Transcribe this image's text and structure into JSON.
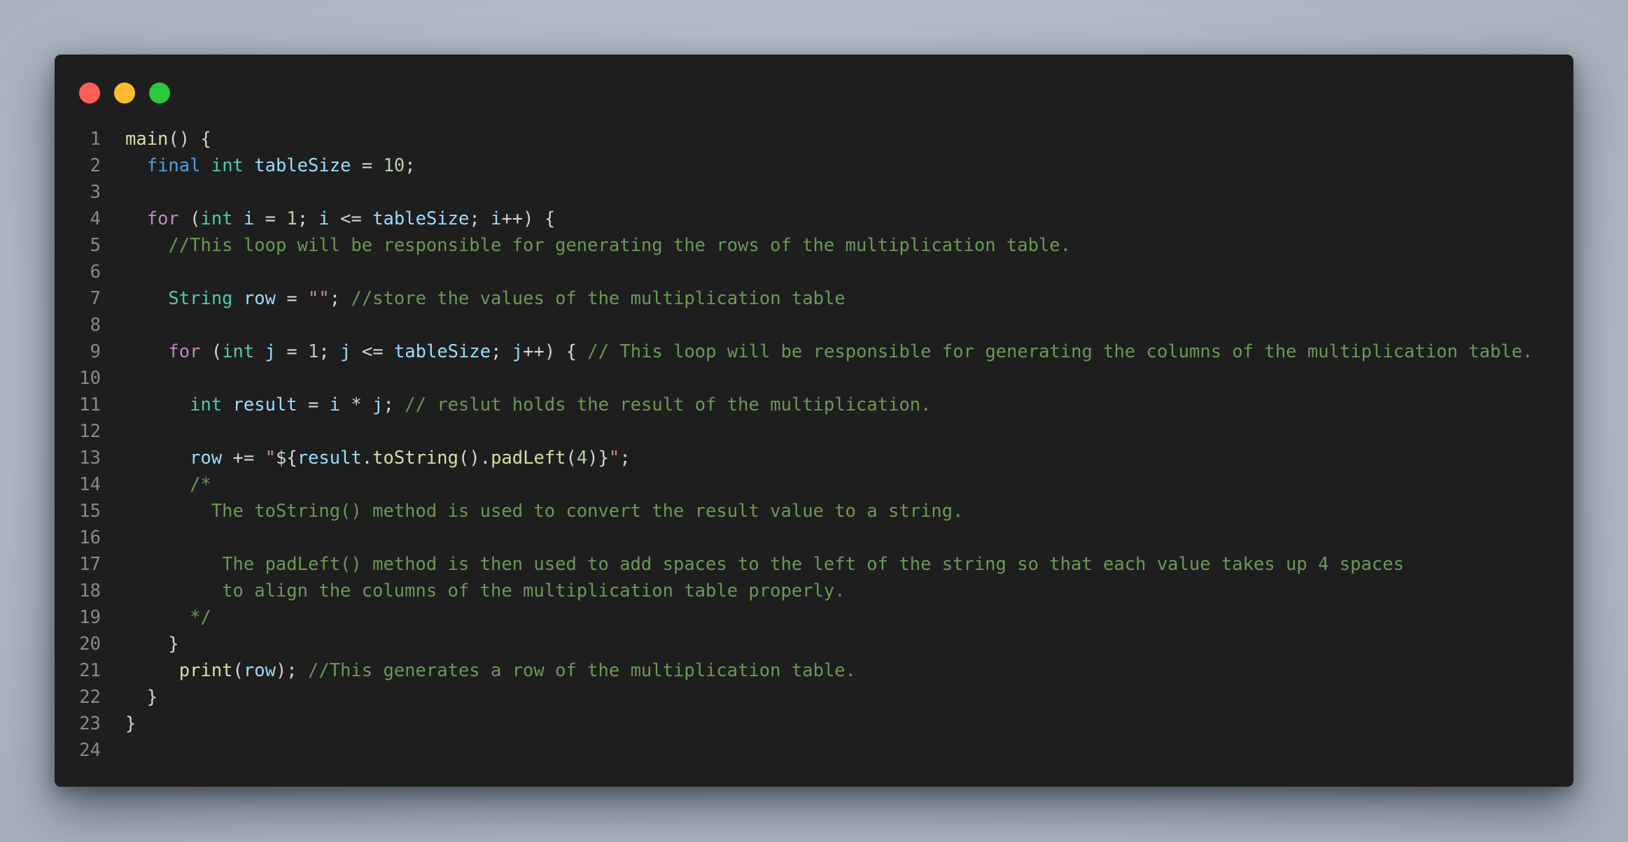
{
  "window": {
    "controls": [
      "close",
      "minimize",
      "maximize"
    ],
    "colors": {
      "background": "#1e1e1e",
      "close": "#ff5f57",
      "minimize": "#febc2e",
      "maximize": "#28c840"
    }
  },
  "editor": {
    "line_numbers": [
      "1",
      "2",
      "3",
      "4",
      "5",
      "6",
      "7",
      "8",
      "9",
      "10",
      "11",
      "12",
      "13",
      "14",
      "15",
      "16",
      "17",
      "18",
      "19",
      "20",
      "21",
      "22",
      "23",
      "24"
    ],
    "lines": [
      [
        [
          "fn",
          "main"
        ],
        [
          "pun",
          "() {"
        ]
      ],
      [
        [
          "pun",
          "  "
        ],
        [
          "kw",
          "final"
        ],
        [
          "pun",
          " "
        ],
        [
          "type",
          "int"
        ],
        [
          "pun",
          " "
        ],
        [
          "var",
          "tableSize"
        ],
        [
          "pun",
          " = "
        ],
        [
          "num",
          "10"
        ],
        [
          "pun",
          ";"
        ]
      ],
      [],
      [
        [
          "pun",
          "  "
        ],
        [
          "ctrl",
          "for"
        ],
        [
          "pun",
          " ("
        ],
        [
          "type",
          "int"
        ],
        [
          "pun",
          " "
        ],
        [
          "var",
          "i"
        ],
        [
          "pun",
          " = "
        ],
        [
          "num",
          "1"
        ],
        [
          "pun",
          "; "
        ],
        [
          "var",
          "i"
        ],
        [
          "pun",
          " <= "
        ],
        [
          "var",
          "tableSize"
        ],
        [
          "pun",
          "; "
        ],
        [
          "var",
          "i"
        ],
        [
          "pun",
          "++) {"
        ]
      ],
      [
        [
          "pun",
          "    "
        ],
        [
          "com",
          "//This loop will be responsible for generating the rows of the multiplication table."
        ]
      ],
      [],
      [
        [
          "pun",
          "    "
        ],
        [
          "type",
          "String"
        ],
        [
          "pun",
          " "
        ],
        [
          "var",
          "row"
        ],
        [
          "pun",
          " = "
        ],
        [
          "str",
          "\"\""
        ],
        [
          "pun",
          "; "
        ],
        [
          "com",
          "//store the values of the multiplication table"
        ]
      ],
      [],
      [
        [
          "pun",
          "    "
        ],
        [
          "ctrl",
          "for"
        ],
        [
          "pun",
          " ("
        ],
        [
          "type",
          "int"
        ],
        [
          "pun",
          " "
        ],
        [
          "var",
          "j"
        ],
        [
          "pun",
          " = "
        ],
        [
          "num",
          "1"
        ],
        [
          "pun",
          "; "
        ],
        [
          "var",
          "j"
        ],
        [
          "pun",
          " <= "
        ],
        [
          "var",
          "tableSize"
        ],
        [
          "pun",
          "; "
        ],
        [
          "var",
          "j"
        ],
        [
          "pun",
          "++) { "
        ],
        [
          "com",
          "// This loop will be responsible for generating the columns of the multiplication table."
        ]
      ],
      [],
      [
        [
          "pun",
          "      "
        ],
        [
          "type",
          "int"
        ],
        [
          "pun",
          " "
        ],
        [
          "var",
          "result"
        ],
        [
          "pun",
          " = "
        ],
        [
          "var",
          "i"
        ],
        [
          "pun",
          " * "
        ],
        [
          "var",
          "j"
        ],
        [
          "pun",
          "; "
        ],
        [
          "com",
          "// reslut holds the result of the multiplication."
        ]
      ],
      [],
      [
        [
          "pun",
          "      "
        ],
        [
          "var",
          "row"
        ],
        [
          "pun",
          " += "
        ],
        [
          "str",
          "\""
        ],
        [
          "pun",
          "${"
        ],
        [
          "var",
          "result"
        ],
        [
          "pun",
          "."
        ],
        [
          "fn",
          "toString"
        ],
        [
          "pun",
          "()."
        ],
        [
          "fn",
          "padLeft"
        ],
        [
          "pun",
          "("
        ],
        [
          "num",
          "4"
        ],
        [
          "pun",
          ")}"
        ],
        [
          "str",
          "\""
        ],
        [
          "pun",
          ";"
        ]
      ],
      [
        [
          "pun",
          "      "
        ],
        [
          "com",
          "/*"
        ]
      ],
      [
        [
          "pun",
          "        "
        ],
        [
          "com",
          "The toString() method is used to convert the result value to a string."
        ]
      ],
      [],
      [
        [
          "pun",
          "         "
        ],
        [
          "com",
          "The padLeft() method is then used to add spaces to the left of the string so that each value takes up 4 spaces"
        ]
      ],
      [
        [
          "pun",
          "         "
        ],
        [
          "com",
          "to align the columns of the multiplication table properly."
        ]
      ],
      [
        [
          "pun",
          "      "
        ],
        [
          "com",
          "*/"
        ]
      ],
      [
        [
          "pun",
          "    }"
        ]
      ],
      [
        [
          "pun",
          "     "
        ],
        [
          "fn",
          "print"
        ],
        [
          "pun",
          "("
        ],
        [
          "var",
          "row"
        ],
        [
          "pun",
          "); "
        ],
        [
          "com",
          "//This generates a row of the multiplication table."
        ]
      ],
      [
        [
          "pun",
          "  }"
        ]
      ],
      [
        [
          "pun",
          "}"
        ]
      ],
      []
    ],
    "token_colors": {
      "kw": "#569cd6",
      "type": "#4ec9b0",
      "ctrl": "#c586c0",
      "fn": "#dcdcaa",
      "var": "#9cdcfe",
      "num": "#b5cea8",
      "str": "#ce9178",
      "com": "#6a9955",
      "pun": "#d4d4d4"
    }
  }
}
